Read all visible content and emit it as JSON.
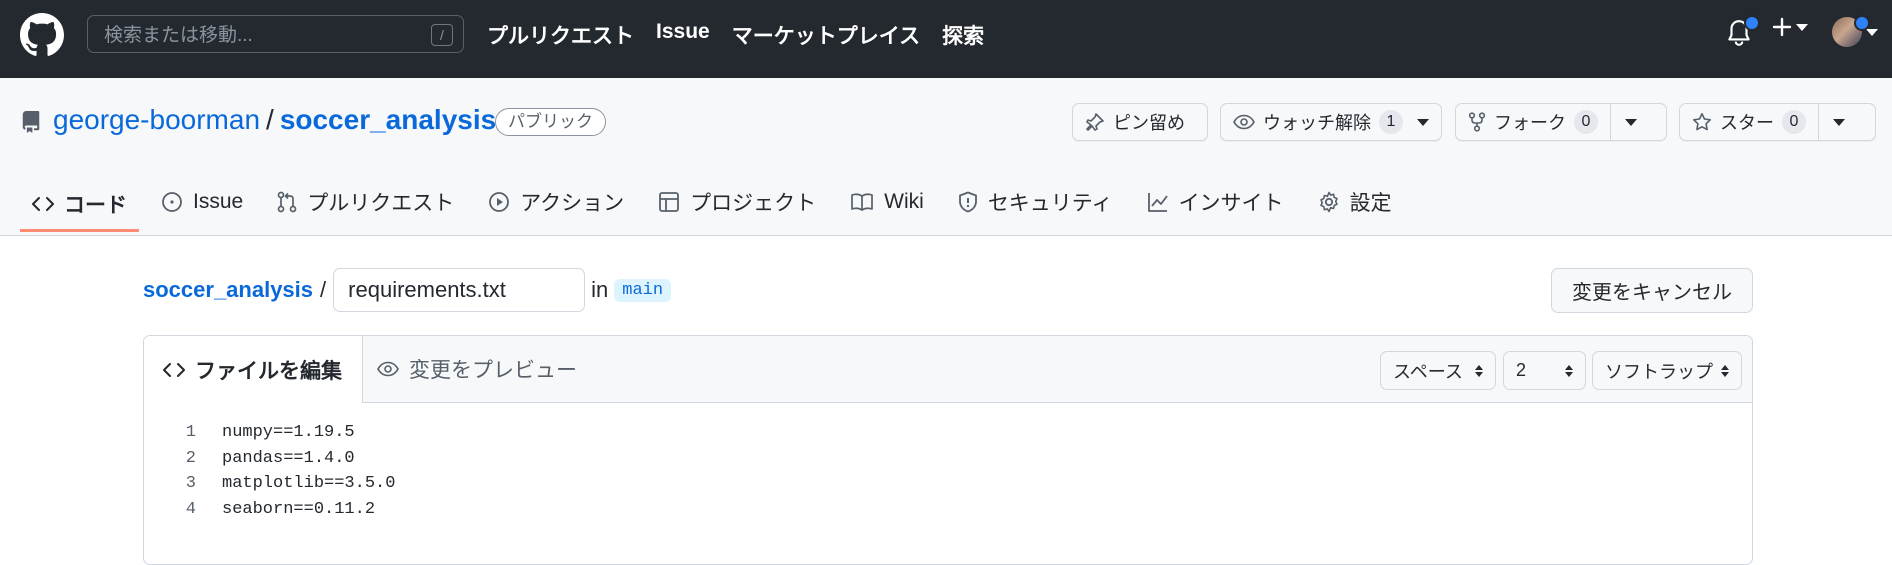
{
  "header": {
    "search_placeholder": "検索または移動...",
    "slash_key": "/",
    "nav": [
      "プルリクエスト",
      "Issue",
      "マーケットプレイス",
      "探索"
    ]
  },
  "repo": {
    "owner": "george-boorman",
    "separator": "/",
    "name": "soccer_analysis",
    "visibility": "パブリック",
    "pin_label": "ピン留め",
    "unwatch_label": "ウォッチ解除",
    "watch_count": "1",
    "fork_label": "フォーク",
    "fork_count": "0",
    "star_label": "スター",
    "star_count": "0"
  },
  "tabs": [
    {
      "label": "コード",
      "icon": "code-icon",
      "selected": true
    },
    {
      "label": "Issue",
      "icon": "issue-icon"
    },
    {
      "label": "プルリクエスト",
      "icon": "pull-request-icon"
    },
    {
      "label": "アクション",
      "icon": "play-icon"
    },
    {
      "label": "プロジェクト",
      "icon": "table-icon"
    },
    {
      "label": "Wiki",
      "icon": "book-icon"
    },
    {
      "label": "セキュリティ",
      "icon": "shield-icon"
    },
    {
      "label": "インサイト",
      "icon": "graph-icon"
    },
    {
      "label": "設定",
      "icon": "gear-icon"
    }
  ],
  "editor": {
    "breadcrumb_repo": "soccer_analysis",
    "breadcrumb_sep": "/",
    "filename": "requirements.txt",
    "in_label": "in",
    "branch": "main",
    "cancel_label": "変更をキャンセル",
    "edit_tab": "ファイルを編集",
    "preview_tab": "変更をプレビュー",
    "indent_mode": "スペース",
    "indent_size": "2",
    "wrap_mode": "ソフトラップ",
    "lines": [
      {
        "n": "1",
        "text": "numpy==1.19.5"
      },
      {
        "n": "2",
        "text": "pandas==1.4.0"
      },
      {
        "n": "3",
        "text": "matplotlib==3.5.0"
      },
      {
        "n": "4",
        "text": "seaborn==0.11.2"
      }
    ]
  },
  "colors": {
    "header_bg": "#24292f",
    "link": "#0969da",
    "tab_underline": "#fd8c73",
    "notification_dot": "#2f81f7"
  }
}
